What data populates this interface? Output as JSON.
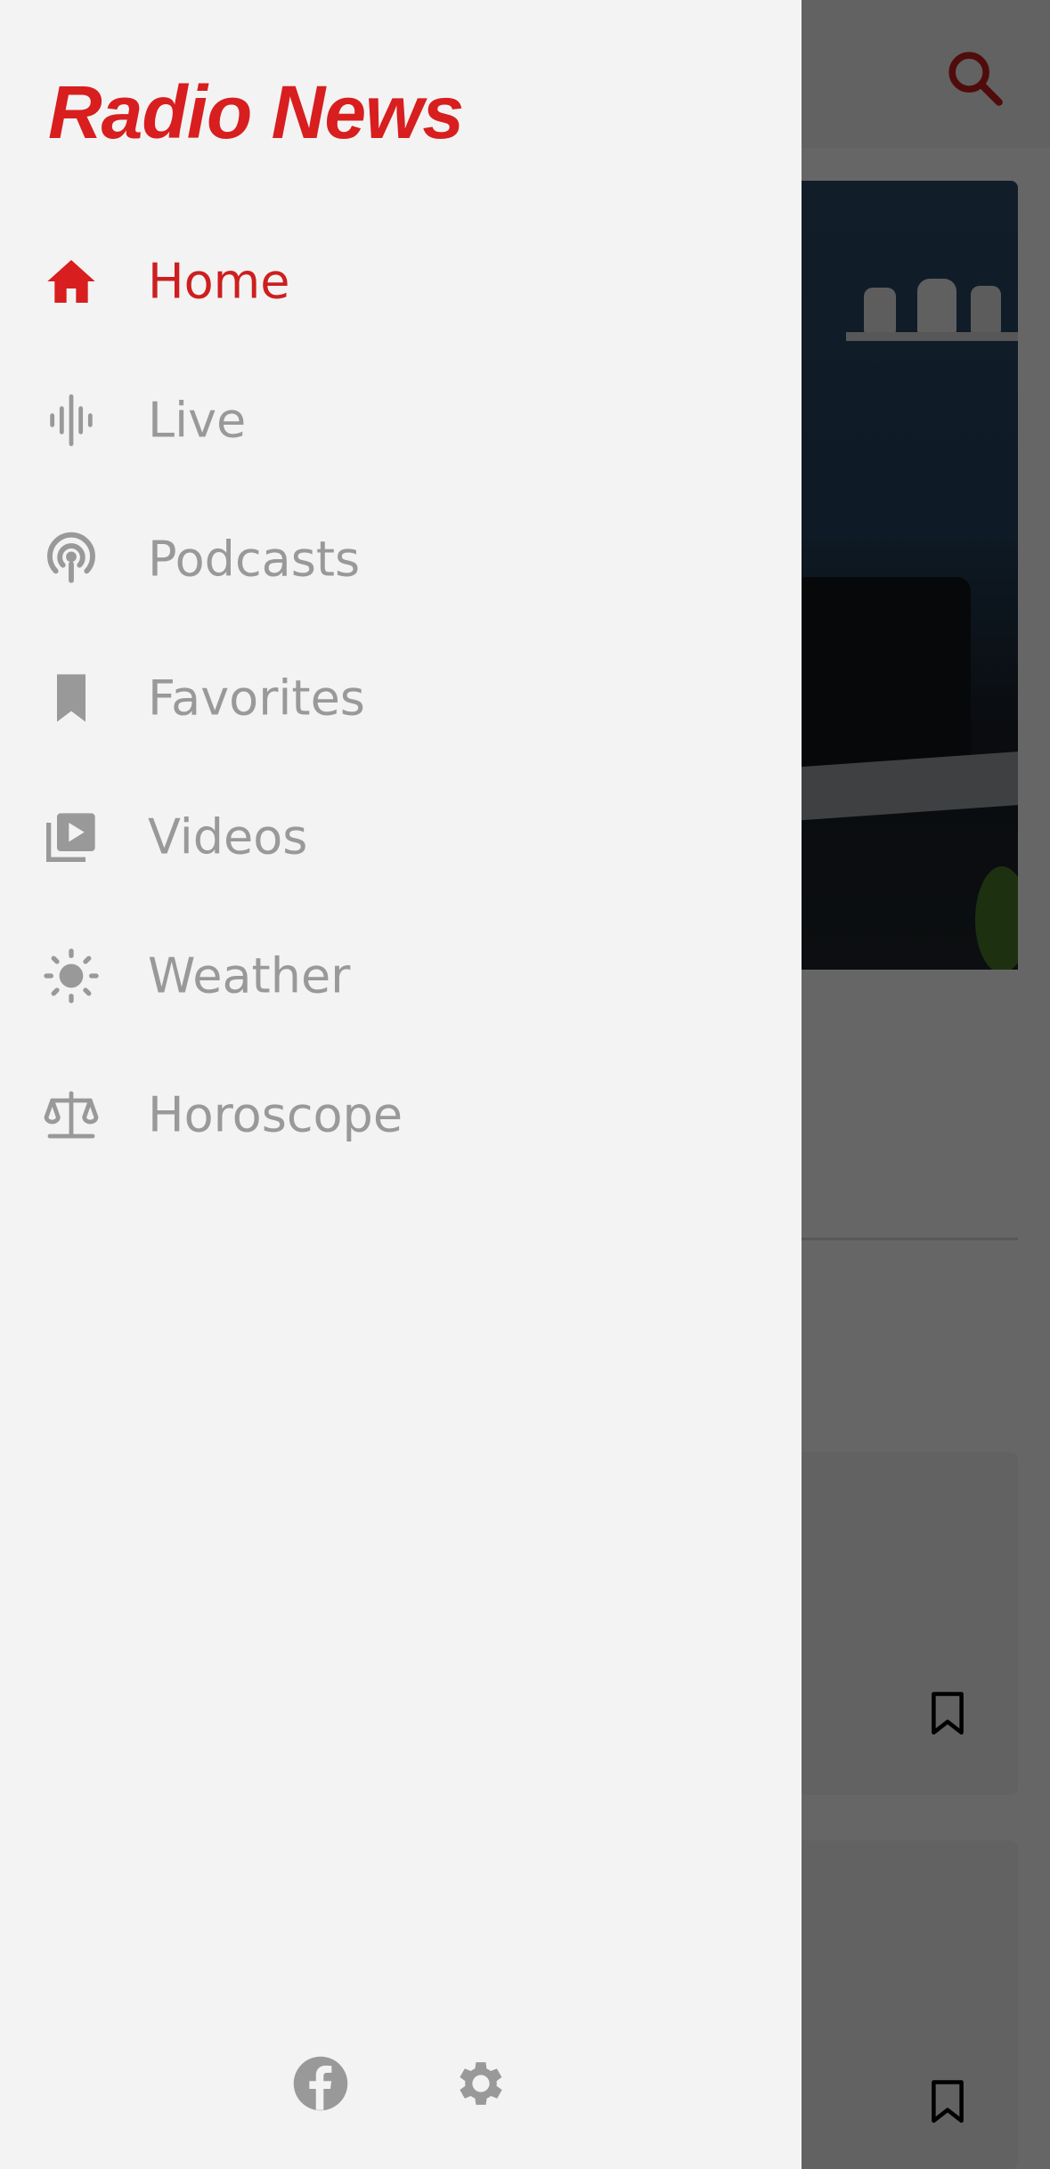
{
  "app": {
    "title": "Radio News"
  },
  "colors": {
    "accent": "#d81e1e",
    "inactive": "#999999",
    "drawer_bg": "#f3f3f3",
    "scrim": "#000000"
  },
  "drawer": {
    "items": [
      {
        "label": "Home",
        "icon": "home-icon",
        "active": true
      },
      {
        "label": "Live",
        "icon": "soundwave-icon",
        "active": false
      },
      {
        "label": "Podcasts",
        "icon": "podcast-icon",
        "active": false
      },
      {
        "label": "Favorites",
        "icon": "bookmark-icon",
        "active": false
      },
      {
        "label": "Videos",
        "icon": "video-library-icon",
        "active": false
      },
      {
        "label": "Weather",
        "icon": "sun-icon",
        "active": false
      },
      {
        "label": "Horoscope",
        "icon": "scales-icon",
        "active": false
      }
    ],
    "footer": [
      {
        "icon": "facebook-icon"
      },
      {
        "icon": "gear-icon"
      }
    ]
  },
  "background": {
    "header_icon": "search-icon",
    "card_icon": "bookmark-outline-icon"
  }
}
